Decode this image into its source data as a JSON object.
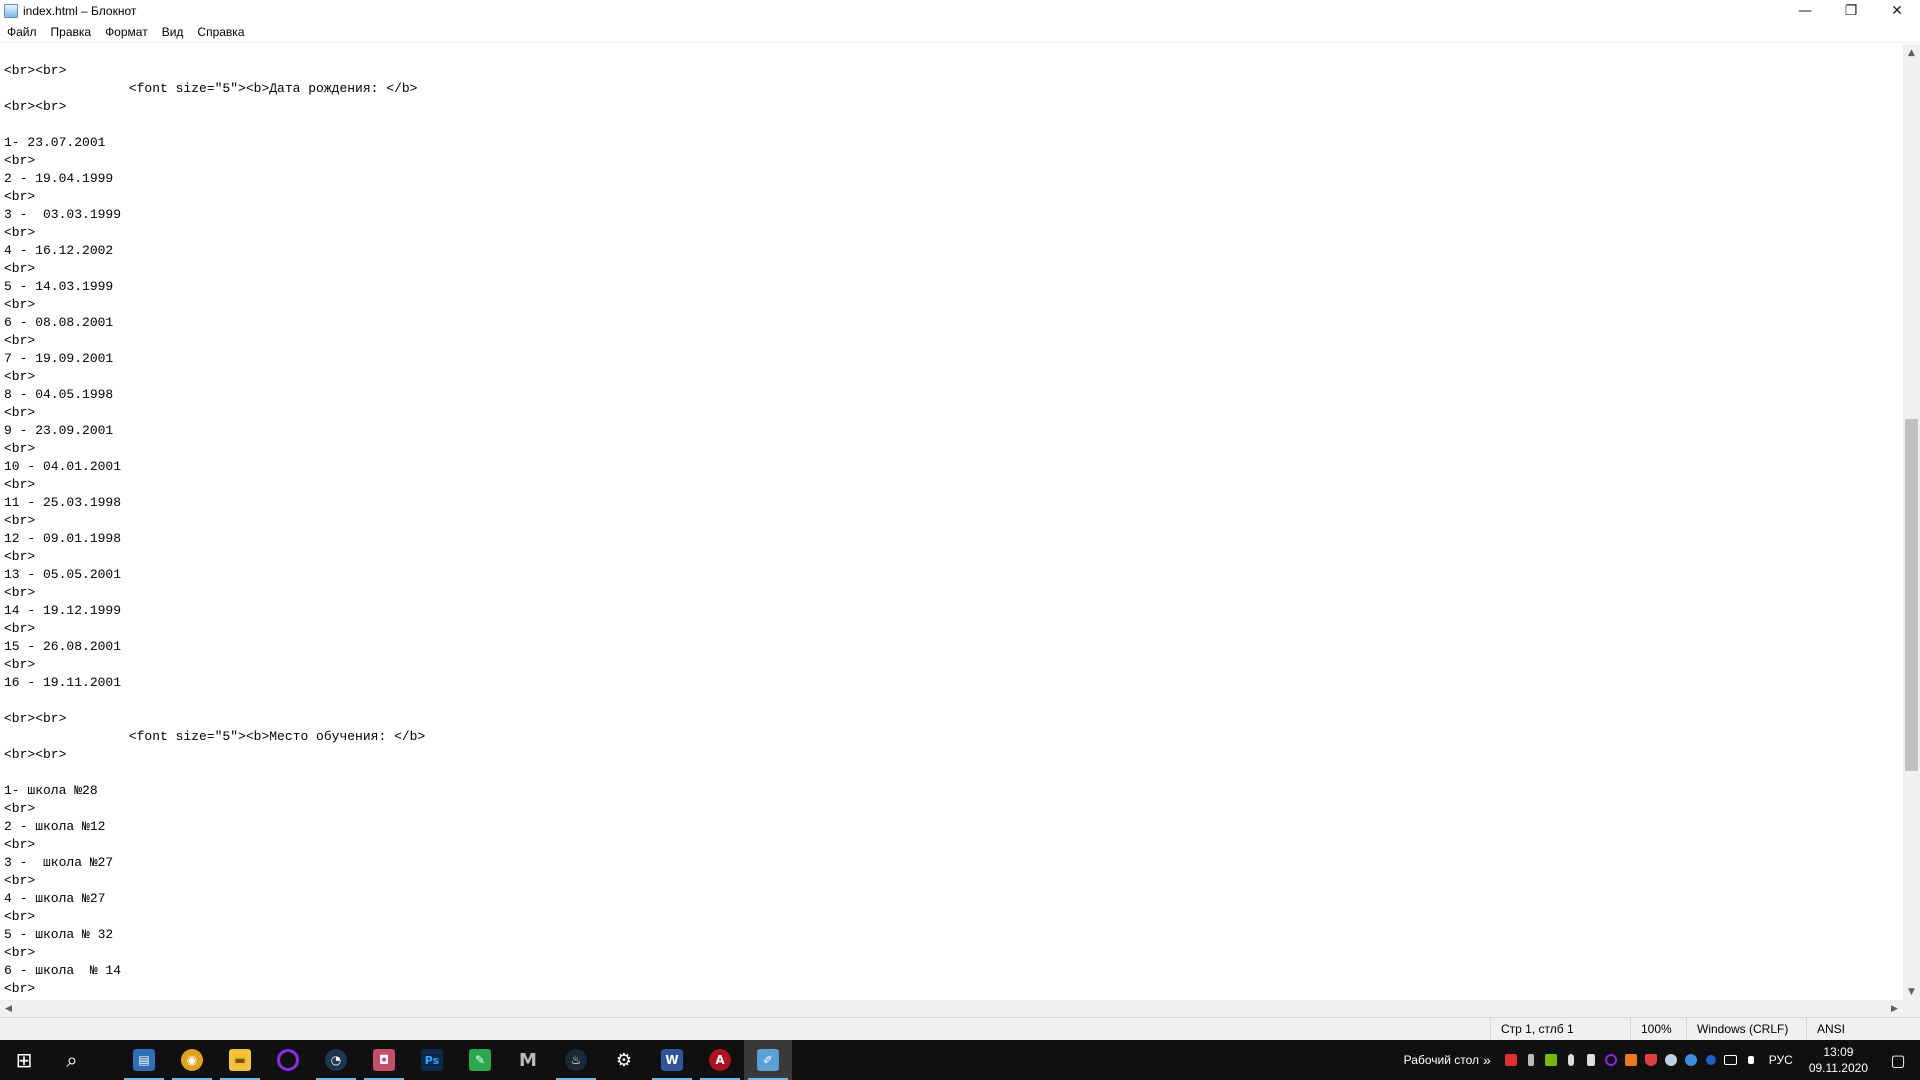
{
  "window": {
    "title": "index.html – Блокнот",
    "minimize_glyph": "—",
    "maximize_glyph": "❐",
    "close_glyph": "✕"
  },
  "menu": [
    {
      "label": "Файл"
    },
    {
      "label": "Правка"
    },
    {
      "label": "Формат"
    },
    {
      "label": "Вид"
    },
    {
      "label": "Справка"
    }
  ],
  "editor": {
    "lines": [
      "<br><br>",
      "                <font size=\"5\"><b>Дата рождения: </b>",
      "<br><br>",
      "",
      "1- 23.07.2001",
      "<br>",
      "2 - 19.04.1999",
      "<br>",
      "3 -  03.03.1999",
      "<br>",
      "4 - 16.12.2002",
      "<br>",
      "5 - 14.03.1999",
      "<br>",
      "6 - 08.08.2001",
      "<br>",
      "7 - 19.09.2001",
      "<br>",
      "8 - 04.05.1998",
      "<br>",
      "9 - 23.09.2001",
      "<br>",
      "10 - 04.01.2001",
      "<br>",
      "11 - 25.03.1998",
      "<br>",
      "12 - 09.01.1998",
      "<br>",
      "13 - 05.05.2001",
      "<br>",
      "14 - 19.12.1999",
      "<br>",
      "15 - 26.08.2001",
      "<br>",
      "16 - 19.11.2001",
      "",
      "<br><br>",
      "                <font size=\"5\"><b>Место обучения: </b>",
      "<br><br>",
      "",
      "1- школа №28",
      "<br>",
      "2 - школа №12",
      "<br>",
      "3 -  школа №27",
      "<br>",
      "4 - школа №27",
      "<br>",
      "5 - школа № 32",
      "<br>",
      "6 - школа  № 14",
      "<br>"
    ]
  },
  "scrollbars": {
    "up": "▲",
    "down": "▼",
    "left": "◀",
    "right": "▶"
  },
  "status": {
    "position": "Стр 1, стлб 1",
    "zoom": "100%",
    "line_ending": "Windows (CRLF)",
    "encoding": "ANSI"
  },
  "taskbar": {
    "apps": [
      {
        "name": "start",
        "glyph": "⊞"
      },
      {
        "name": "search",
        "glyph": "⌕"
      },
      {
        "name": "network-app",
        "glyph": "▤",
        "color": "#2f6fb5"
      },
      {
        "name": "chrome",
        "glyph": "◉",
        "color": "#e0a020"
      },
      {
        "name": "explorer",
        "glyph": "▬",
        "color": "#f3c13a"
      },
      {
        "name": "cortana",
        "glyph": "◯",
        "color": "#8a2be2"
      },
      {
        "name": "headset-app",
        "glyph": "◔",
        "color": "#3aa0e0"
      },
      {
        "name": "game-app",
        "glyph": "◘",
        "color": "#c0506a"
      },
      {
        "name": "photoshop",
        "glyph": "Ps",
        "color": "#0a2a4a"
      },
      {
        "name": "green-app",
        "glyph": "✎",
        "color": "#2aa84a"
      },
      {
        "name": "m-app",
        "glyph": "M",
        "color": "#333333"
      },
      {
        "name": "steam",
        "glyph": "♨",
        "color": "#1b2838"
      },
      {
        "name": "settings",
        "glyph": "⚙",
        "color": "#101010"
      },
      {
        "name": "word",
        "glyph": "W",
        "color": "#2b579a"
      },
      {
        "name": "red-app",
        "glyph": "A",
        "color": "#b01020"
      },
      {
        "name": "notepad",
        "glyph": "✐",
        "color": "#5aa0d8"
      }
    ],
    "desktop_label": "Рабочий стол",
    "desktop_chevron": "»",
    "language": "РУС",
    "time": "13:09",
    "date": "09.11.2020",
    "notification_glyph": "▢"
  },
  "colors": {
    "scroll_thumb": "#c1c1c1",
    "taskbar_bg": "#101010",
    "accent": "#76b9ed"
  }
}
